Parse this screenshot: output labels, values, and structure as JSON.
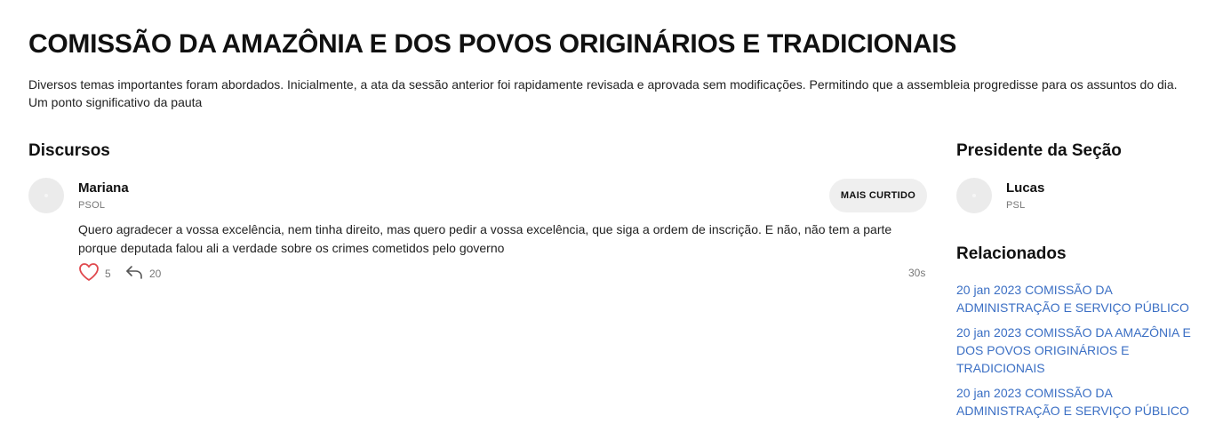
{
  "page": {
    "title": "COMISSÃO DA AMAZÔNIA E DOS POVOS ORIGINÁRIOS E TRADICIONAIS",
    "summary": "Diversos temas importantes foram abordados. Inicialmente, a ata da sessão anterior foi rapidamente revisada e aprovada sem modificações. Permitindo que a assembleia progredisse para os assuntos do dia. Um ponto significativo da pauta"
  },
  "discursos": {
    "heading": "Discursos",
    "items": [
      {
        "speaker": "Mariana",
        "party": "PSOL",
        "badge": "MAIS CURTIDO",
        "text": "Quero agradecer a vossa excelência, nem tinha direito, mas quero pedir a vossa excelência, que siga a ordem de inscrição. E não, não tem a parte porque deputada falou ali a verdade sobre os crimes cometidos pelo governo",
        "likes": "5",
        "replies": "20",
        "time": "30s",
        "like_icon": "heart-icon",
        "reply_icon": "reply-arrow-icon"
      }
    ]
  },
  "presidente": {
    "heading": "Presidente da Seção",
    "name": "Lucas",
    "party": "PSL"
  },
  "relacionados": {
    "heading": "Relacionados",
    "items": [
      {
        "label": "20 jan 2023 COMISSÃO DA ADMINISTRAÇÃO E SERVIÇO PÚBLICO"
      },
      {
        "label": "20 jan 2023 COMISSÃO DA AMAZÔNIA E DOS POVOS ORIGINÁRIOS E TRADICIONAIS"
      },
      {
        "label": "20 jan 2023 COMISSÃO DA ADMINISTRAÇÃO E SERVIÇO PÚBLICO"
      }
    ]
  },
  "colors": {
    "heart": "#e0484d",
    "link": "#3b6fc4",
    "badge_bg": "#efefef",
    "avatar_bg": "#ebebeb"
  }
}
